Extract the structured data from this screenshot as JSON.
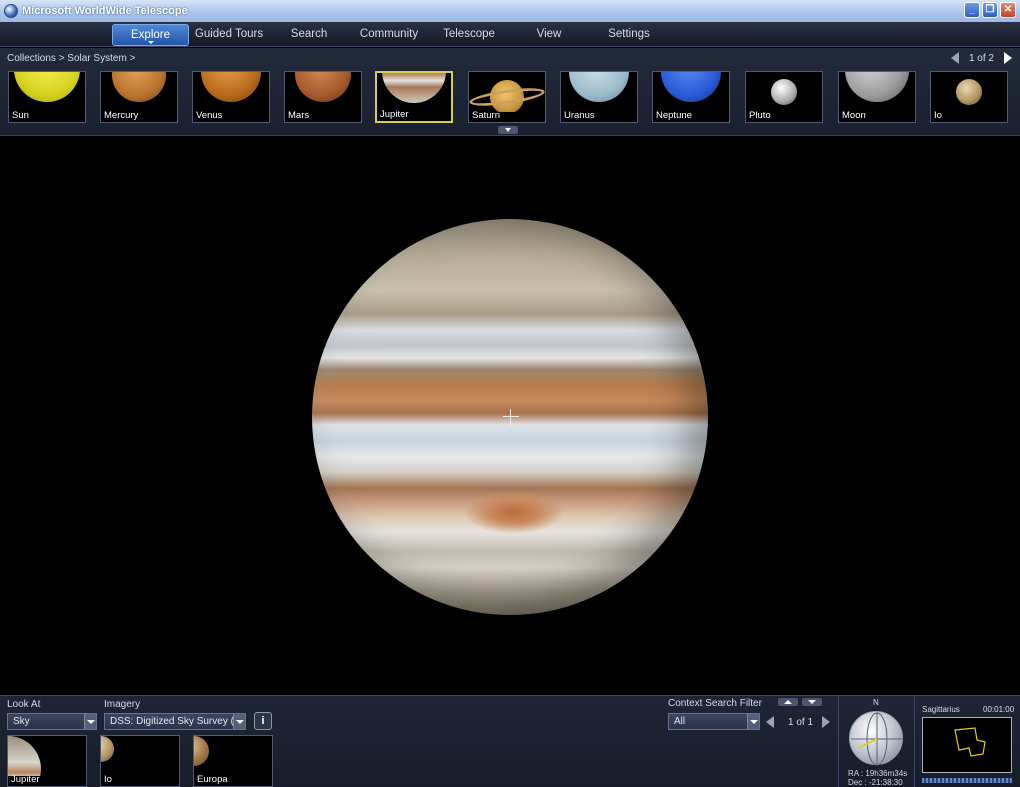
{
  "window": {
    "title": "Microsoft WorldWide Telescope"
  },
  "menu": {
    "items": [
      "Explore",
      "Guided Tours",
      "Search",
      "Community",
      "Telescope",
      "View",
      "Settings"
    ]
  },
  "explore": {
    "breadcrumb": "Collections > Solar System >",
    "pager": "1 of 2",
    "selected": "Jupiter",
    "thumbnails": [
      "Sun",
      "Mercury",
      "Venus",
      "Mars",
      "Jupiter",
      "Saturn",
      "Uranus",
      "Neptune",
      "Pluto",
      "Moon",
      "Io"
    ]
  },
  "bottom": {
    "look_at_label": "Look At",
    "look_at_value": "Sky",
    "imagery_label": "Imagery",
    "imagery_value": "DSS: Digitized Sky Survey (...",
    "info_button": "i",
    "context_label": "Context Search Filter",
    "context_value": "All",
    "context_pager": "1 of 1",
    "context_items": [
      "Jupiter",
      "Io",
      "Europa"
    ],
    "compass_n": "N",
    "ra": "RA : 19h36m34s",
    "dec": "Dec : -21:38:30",
    "constellation": "Sagittarius",
    "time": "00:01:00"
  },
  "colors": {
    "accent": "#2356a7",
    "selection": "#d4d04a",
    "panel": "#1a2030"
  }
}
